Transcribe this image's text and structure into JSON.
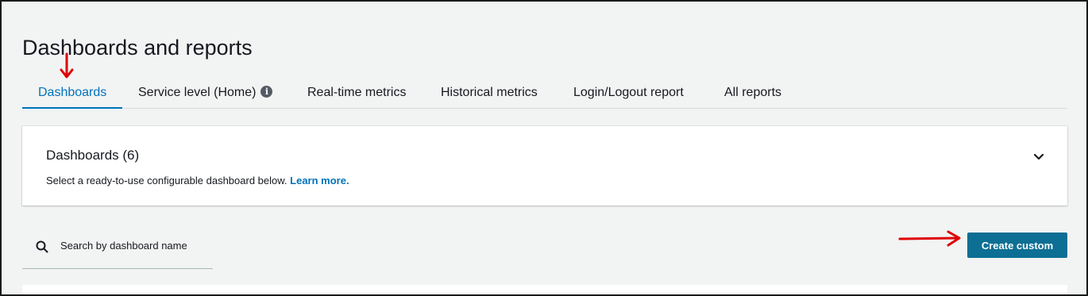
{
  "page": {
    "title": "Dashboards and reports"
  },
  "tabs": [
    {
      "label": "Dashboards",
      "active": true
    },
    {
      "label": "Service level (Home)",
      "has_info_icon": true
    },
    {
      "label": "Real-time metrics"
    },
    {
      "label": "Historical metrics"
    },
    {
      "label": "Login/Logout report"
    },
    {
      "label": "All reports"
    }
  ],
  "dashboards_panel": {
    "title": "Dashboards (6)",
    "description": "Select a ready-to-use configurable dashboard below.",
    "link": "Learn more.",
    "toggle_icon": "chevron-down-icon"
  },
  "search": {
    "placeholder": "Search by dashboard name",
    "value": "",
    "icon": "search-icon"
  },
  "actions": {
    "create_custom_label": "Create custom"
  },
  "annotations": {
    "arrow_icon": "red-arrow-icon"
  },
  "colors": {
    "accent": "#0073bb",
    "button": "#0d6f94",
    "background": "#f2f3f3",
    "annotation": "#e00000"
  }
}
